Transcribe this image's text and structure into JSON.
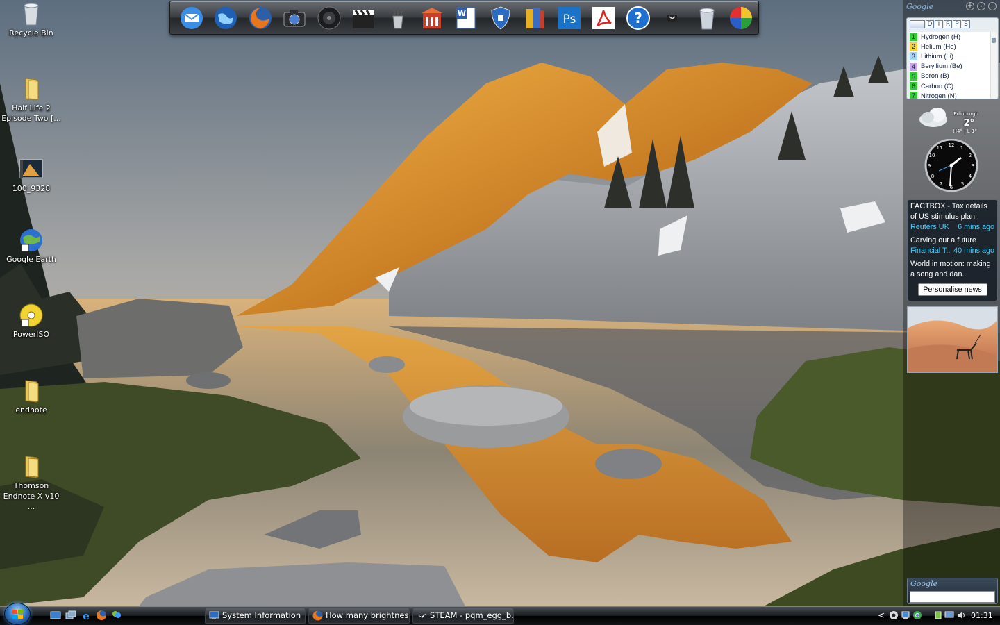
{
  "desktop": {
    "icons": [
      {
        "label": "Recycle Bin",
        "icon": "recycle-bin-icon"
      },
      {
        "label": "Half Life 2 Episode Two [...",
        "icon": "folder-icon"
      },
      {
        "label": "100_9328",
        "icon": "video-file-icon"
      },
      {
        "label": "Google Earth",
        "icon": "google-earth-icon"
      },
      {
        "label": "PowerISO",
        "icon": "poweriso-icon"
      },
      {
        "label": "endnote",
        "icon": "folder-icon"
      },
      {
        "label": "Thomson Endnote X v10 ...",
        "icon": "folder-icon"
      }
    ]
  },
  "dock": {
    "items": [
      "mail-icon",
      "web-globe-icon",
      "firefox-icon",
      "camera-icon",
      "speaker-icon",
      "clapperboard-icon",
      "pencil-cup-icon",
      "library-icon",
      "word-icon",
      "shield-icon",
      "books-icon",
      "photoshop-icon",
      "acrobat-icon",
      "help-icon",
      "terminal-icon",
      "trash-icon",
      "color-wheel-icon"
    ],
    "ps_text": "Ps",
    "help_text": "?",
    "word_text": "W"
  },
  "gadgets": {
    "google_header": "Google",
    "periodic_tabs": [
      "D",
      "I",
      "R",
      "P",
      "S"
    ],
    "elements": [
      {
        "num": "1",
        "name": "Hydrogen (H)",
        "color": "#33cc33"
      },
      {
        "num": "2",
        "name": "Helium (He)",
        "color": "#f4d23a"
      },
      {
        "num": "3",
        "name": "Lithium (Li)",
        "color": "#a9d8f5"
      },
      {
        "num": "4",
        "name": "Beryllium (Be)",
        "color": "#c6a6e6"
      },
      {
        "num": "5",
        "name": "Boron (B)",
        "color": "#33cc33"
      },
      {
        "num": "6",
        "name": "Carbon (C)",
        "color": "#33cc33"
      },
      {
        "num": "7",
        "name": "Nitrogen (N)",
        "color": "#33cc33"
      }
    ],
    "weather": {
      "city": "Edinburgh",
      "temp": "2°",
      "hilo": "H4° | L-1°"
    },
    "news": {
      "items": [
        {
          "headline": "FACTBOX - Tax details of US stimulus plan",
          "source": "Reuters UK",
          "age": "6 mins ago"
        },
        {
          "headline": "Carving out a future",
          "source": "Financial T..",
          "age": "40 mins ago"
        },
        {
          "headline": "World in motion: making a song and dan..",
          "source": "",
          "age": ""
        }
      ],
      "button": "Personalise news"
    },
    "search_logo": "Google"
  },
  "taskbar": {
    "tasks": [
      {
        "label": "System Information",
        "icon": "system-info-icon"
      },
      {
        "label": "How many brightnes...",
        "icon": "firefox-icon"
      },
      {
        "label": "STEAM - pqm_egg_b...",
        "icon": "steam-icon"
      }
    ],
    "clock": "01:31",
    "tray_chevron": "<"
  }
}
